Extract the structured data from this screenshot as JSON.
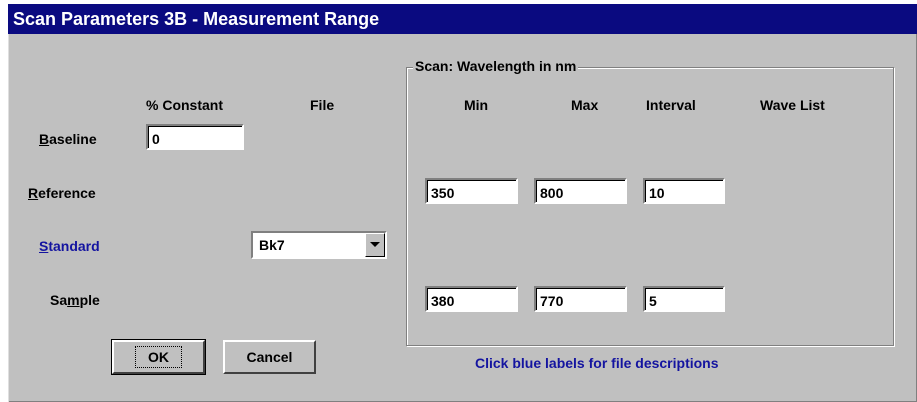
{
  "window": {
    "title": "Scan Parameters 3B - Measurement Range"
  },
  "headers": {
    "percent_constant": "% Constant",
    "file": "File"
  },
  "rows": {
    "baseline": {
      "access_key": "B",
      "label_rest": "aseline",
      "value": "0"
    },
    "reference": {
      "access_key": "R",
      "label_rest": "eference"
    },
    "standard": {
      "access_key": "S",
      "label_rest": "tandard",
      "file": "Bk7"
    },
    "sample": {
      "label_pre": "Sa",
      "access_key": "m",
      "label_rest": "ple"
    }
  },
  "scan": {
    "group_title": "Scan: Wavelength in nm",
    "columns": {
      "min": "Min",
      "max": "Max",
      "interval": "Interval",
      "wave_list": "Wave List"
    },
    "reference": {
      "min": "350",
      "max": "800",
      "interval": "10"
    },
    "sample": {
      "min": "380",
      "max": "770",
      "interval": "5"
    }
  },
  "buttons": {
    "ok": "OK",
    "cancel": "Cancel"
  },
  "hint": "Click blue labels for file descriptions",
  "colors": {
    "title_bar": "#0a0a80",
    "link_blue": "#1414a0",
    "dialog_bg": "#c0c0c0"
  },
  "icons": {
    "combo_arrow": "triangle-down"
  }
}
